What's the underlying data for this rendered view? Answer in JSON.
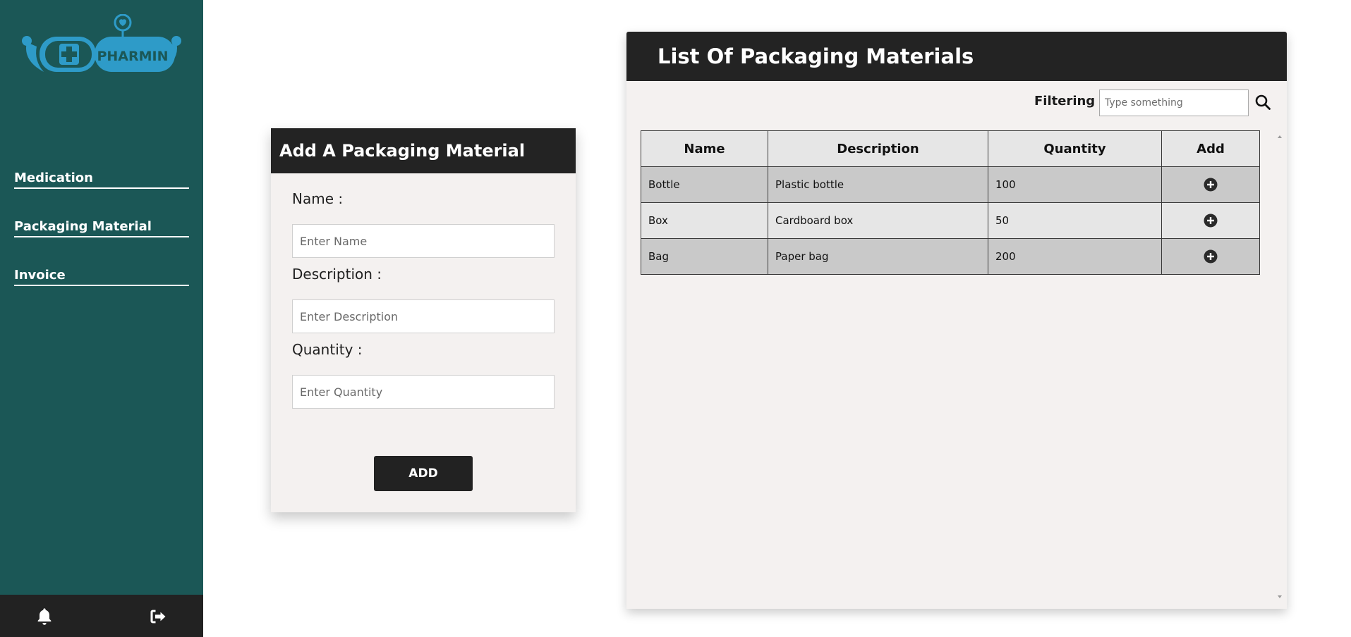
{
  "brand": {
    "logo_text": "PHARMIN",
    "colors": {
      "sidebar": "#1b5756",
      "logo": "#2e9bc8",
      "header": "#232323",
      "card": "#f4f1f0"
    }
  },
  "sidebar": {
    "items": [
      {
        "label": "Medication"
      },
      {
        "label": "Packaging Material"
      },
      {
        "label": "Invoice"
      }
    ],
    "footer_icons": [
      "bell-icon",
      "logout-icon"
    ]
  },
  "form": {
    "title": "Add A Packaging Material",
    "name_label": "Name :",
    "name_placeholder": "Enter Name",
    "description_label": "Description :",
    "description_placeholder": "Enter Description",
    "quantity_label": "Quantity :",
    "quantity_placeholder": "Enter Quantity",
    "submit_label": "ADD"
  },
  "list": {
    "title": "List Of Packaging Materials",
    "filter_label": "Filtering :",
    "filter_placeholder": "Type something",
    "columns": [
      "Name",
      "Description",
      "Quantity",
      "Add"
    ],
    "rows": [
      {
        "name": "Bottle",
        "description": "Plastic bottle",
        "quantity": "100"
      },
      {
        "name": "Box",
        "description": "Cardboard box",
        "quantity": "50"
      },
      {
        "name": "Bag",
        "description": "Paper bag",
        "quantity": "200"
      }
    ]
  }
}
